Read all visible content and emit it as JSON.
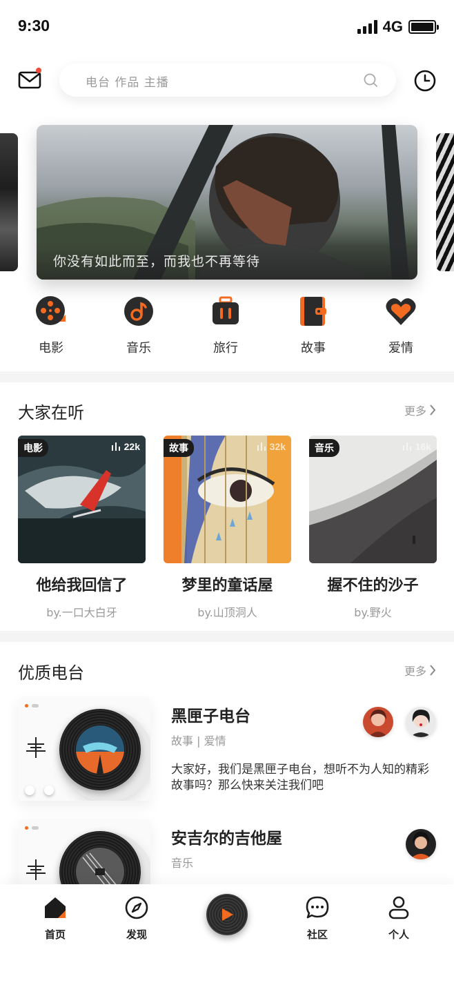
{
  "status": {
    "time": "9:30",
    "network": "4G"
  },
  "search": {
    "placeholder": "电台 作品 主播"
  },
  "banner": {
    "caption": "你没有如此而至，而我也不再等待"
  },
  "categories": [
    {
      "label": "电影",
      "icon": "film-reel-icon"
    },
    {
      "label": "音乐",
      "icon": "music-note-icon"
    },
    {
      "label": "旅行",
      "icon": "luggage-icon"
    },
    {
      "label": "故事",
      "icon": "book-icon"
    },
    {
      "label": "爱情",
      "icon": "heart-icon"
    }
  ],
  "listening": {
    "title": "大家在听",
    "more": "更多",
    "cards": [
      {
        "tag": "电影",
        "plays": "22k",
        "title": "他给我回信了",
        "author": "by.一口大白牙"
      },
      {
        "tag": "故事",
        "plays": "32k",
        "title": "梦里的童话屋",
        "author": "by.山顶洞人"
      },
      {
        "tag": "音乐",
        "plays": "16k",
        "title": "握不住的沙子",
        "author": "by.野火"
      }
    ]
  },
  "stations": {
    "title": "优质电台",
    "more": "更多",
    "items": [
      {
        "name": "黑匣子电台",
        "tags": "故事 | 爱情",
        "desc": "大家好，我们是黑匣子电台，想听不为人知的精彩故事吗？那么快来关注我们吧"
      },
      {
        "name": "安吉尔的吉他屋",
        "tags": "音乐",
        "desc": ""
      }
    ]
  },
  "tabbar": [
    {
      "label": "首页",
      "icon": "home-icon",
      "active": true
    },
    {
      "label": "发现",
      "icon": "compass-icon"
    },
    {
      "label": "社区",
      "icon": "chat-bubble-icon"
    },
    {
      "label": "个人",
      "icon": "person-icon"
    }
  ],
  "colors": {
    "accent": "#f36b21",
    "dark": "#1c1c1c",
    "muted": "#999999"
  }
}
